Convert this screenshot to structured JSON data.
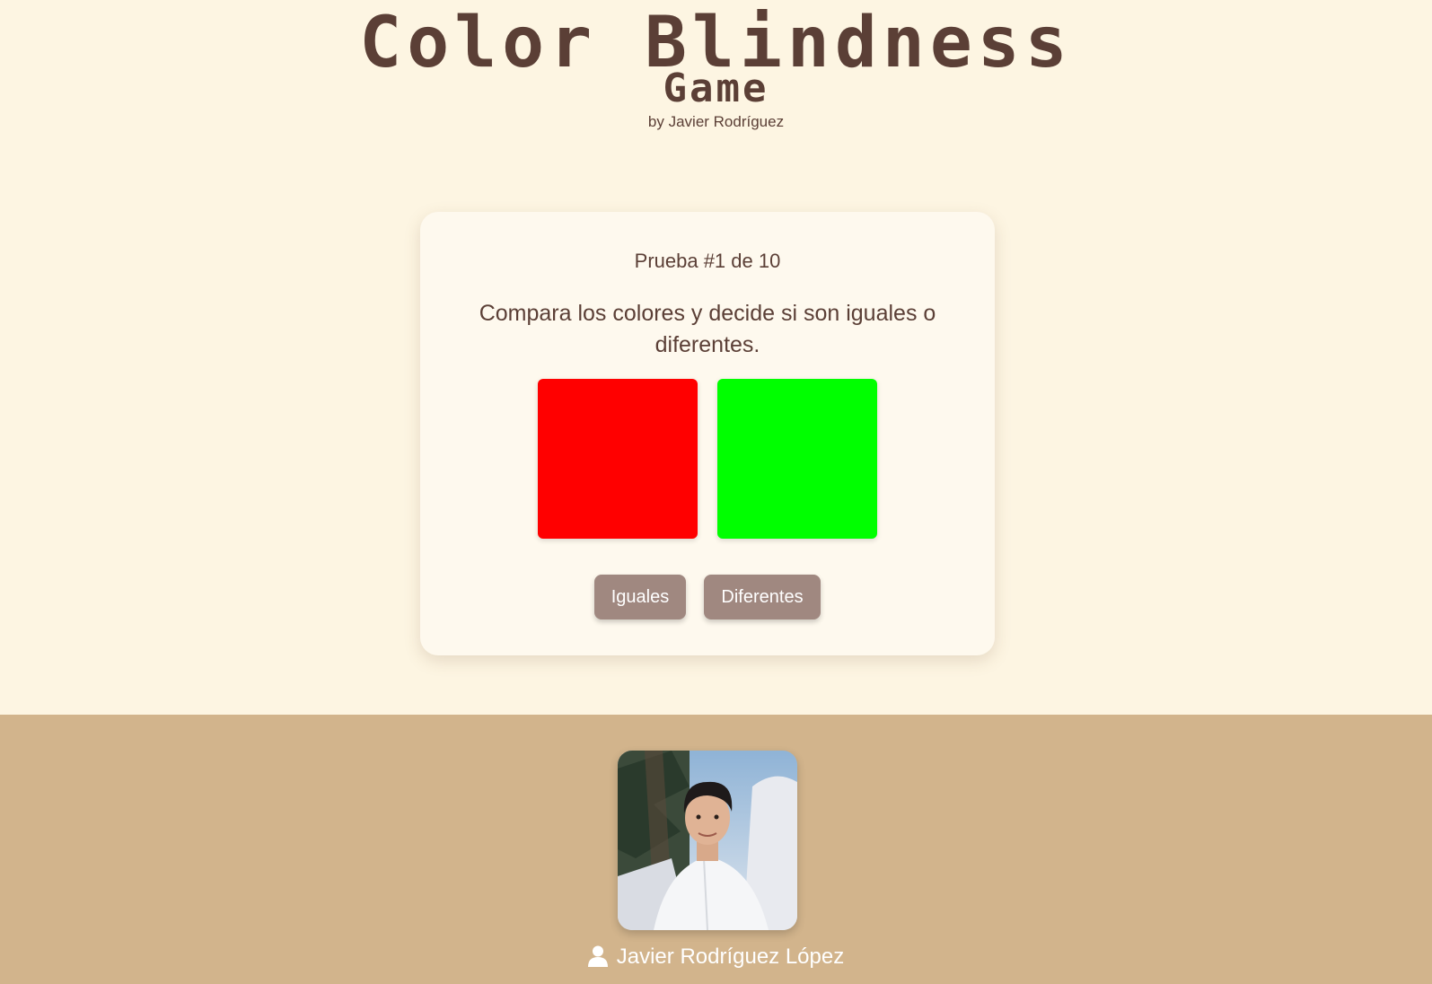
{
  "header": {
    "title": "Color Blindness",
    "subtitle": "Game",
    "byline": "by Javier Rodríguez"
  },
  "card": {
    "trial": "Prueba #1 de 10",
    "instructions": "Compara los colores y decide si son iguales o diferentes.",
    "swatches": {
      "left_color": "#ff0000",
      "right_color": "#00ff00"
    },
    "buttons": {
      "equal_label": "Iguales",
      "different_label": "Diferentes"
    }
  },
  "footer": {
    "avatar_icon": "profile-photo",
    "author_icon": "user-icon",
    "author_name": "Javier Rodríguez López"
  },
  "colors": {
    "background": "#fdf5e2",
    "card": "#fef9ee",
    "text": "#5b3f36",
    "button": "#a08880",
    "footer": "#d2b48c"
  }
}
